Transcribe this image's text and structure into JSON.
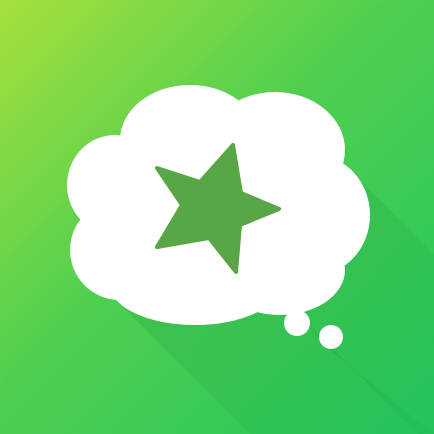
{
  "app_icon": {
    "icon_name": "thought-bubble-star-icon",
    "colors": {
      "gradient_top_left": "#a6e03c",
      "gradient_mid": "#4fcf4f",
      "gradient_bottom_right": "#22c55e",
      "long_shadow": "#1f9a3d",
      "bubble": "#ffffff",
      "star": "#59a646"
    }
  }
}
